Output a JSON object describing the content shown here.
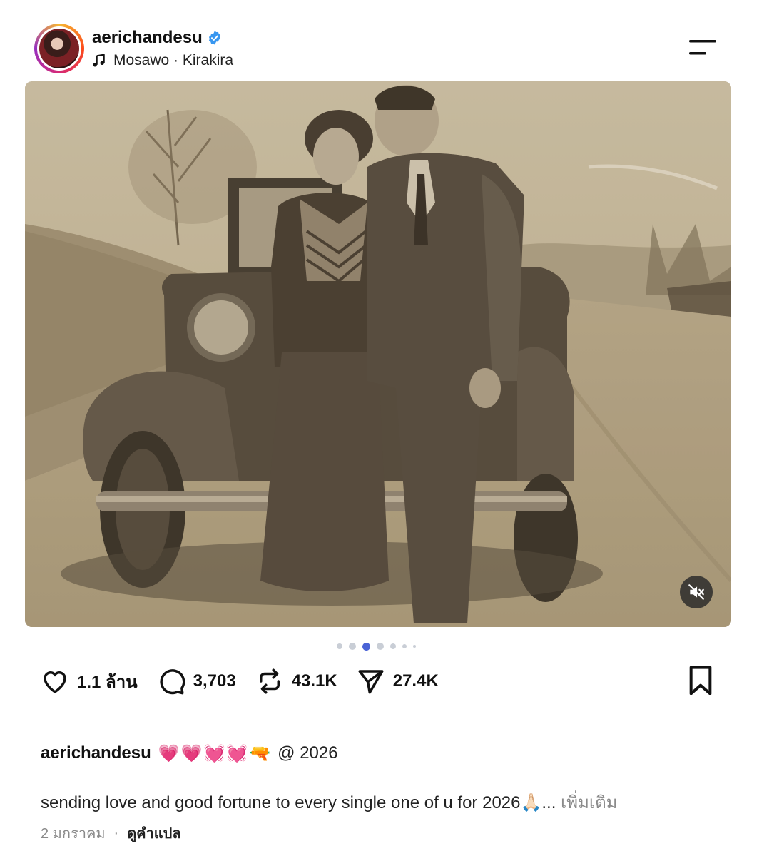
{
  "header": {
    "username": "aerichandesu",
    "music": "Mosawo · Kirakira"
  },
  "actions": {
    "likes": "1.1 ล้าน",
    "comments": "3,703",
    "reposts": "43.1K",
    "shares": "27.4K"
  },
  "carousel": {
    "count": 7,
    "active_index": 2
  },
  "caption": {
    "username": "aerichandesu",
    "emojis": "💗💗💓💓🔫",
    "mention": "@ 2026",
    "text": "sending love and good fortune to every single one of u for 2026🙏🏻...",
    "see_more": "เพิ่มเติม"
  },
  "meta": {
    "date": "2 มกราคม",
    "separator": "·",
    "translate": "ดูคำแปล"
  },
  "colors": {
    "verified": "#3897f0",
    "active_dot": "#4a63d6",
    "muted_text": "#8a8a8a"
  }
}
